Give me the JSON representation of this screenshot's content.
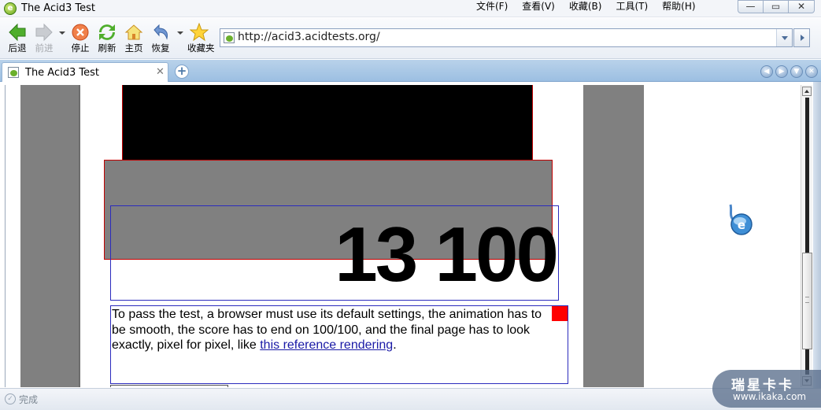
{
  "window": {
    "title": "The Acid3 Test",
    "app_icon_glyph": "e"
  },
  "menu": [
    {
      "label": "文件(F)"
    },
    {
      "label": "查看(V)"
    },
    {
      "label": "收藏(B)"
    },
    {
      "label": "工具(T)"
    },
    {
      "label": "帮助(H)"
    }
  ],
  "window_controls": {
    "minimize": "—",
    "maximize": "▭",
    "close": "✕"
  },
  "toolbar": {
    "back": "后退",
    "forward": "前进",
    "stop": "停止",
    "refresh": "刷新",
    "home": "主页",
    "restore": "恢复",
    "favorites": "收藏夹"
  },
  "address_bar": {
    "url": "http://acid3.acidtests.org/"
  },
  "tabs": [
    {
      "title": "The Acid3 Test",
      "close": "✕"
    }
  ],
  "new_tab": "+",
  "tab_nav": {
    "prev": "◀",
    "next": "▶",
    "menu": "▼",
    "close": "✕"
  },
  "page": {
    "score": "13 100",
    "description_prefix": "To pass the test, a browser must use its default settings, the animation has to be smooth, the score has to end on 100/100, and the final page has to look exactly, pixel for pixel, like ",
    "reference_link": "this reference rendering",
    "description_suffix": "."
  },
  "status": {
    "text": "完成",
    "icon_glyph": "✓"
  },
  "watermark": {
    "brand": "瑞星卡卡",
    "url": "www.ikaka.com"
  },
  "colors": {
    "accent_blue": "#9cbfe2",
    "page_gray": "#808080",
    "border_red": "#c00000",
    "border_blue": "#2b2bbd",
    "link": "#1a1aa6",
    "red_square": "#ff0000"
  }
}
